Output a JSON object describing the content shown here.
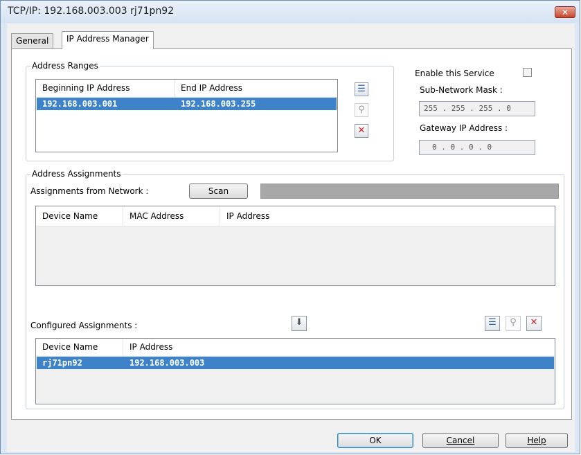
{
  "window": {
    "title": "TCP/IP: 192.168.003.003  rj71pn92",
    "close_icon": "close-x"
  },
  "tabs": [
    {
      "label": "General",
      "active": false
    },
    {
      "label": "IP Address Manager",
      "active": true
    }
  ],
  "address_ranges": {
    "group_label": "Address Ranges",
    "columns": [
      "Beginning IP Address",
      "End IP Address"
    ],
    "rows": [
      {
        "begin": "192.168.003.001",
        "end": "192.168.003.255",
        "selected": true
      }
    ],
    "icons": [
      "add-list-icon",
      "search-icon",
      "delete-icon"
    ]
  },
  "service": {
    "enable_label": "Enable this Service",
    "enabled": false,
    "subnet_label": "Sub-Network Mask :",
    "subnet_value": "255 . 255 . 255 .  0",
    "gateway_label": "Gateway IP Address :",
    "gateway_value": "0 .  0 .  0 .  0"
  },
  "address_assignments": {
    "group_label": "Address Assignments",
    "network_label": "Assignments from Network :",
    "scan_button": "Scan",
    "network_columns": [
      "Device Name",
      "MAC Address",
      "IP Address"
    ],
    "configured_label": "Configured Assignments :",
    "configured_columns": [
      "Device Name",
      "IP Address"
    ],
    "configured_rows": [
      {
        "device": "rj71pn92",
        "ip": "192.168.003.003",
        "selected": true
      }
    ]
  },
  "buttons": {
    "ok": "OK",
    "cancel": "Cancel",
    "help": "Help"
  }
}
